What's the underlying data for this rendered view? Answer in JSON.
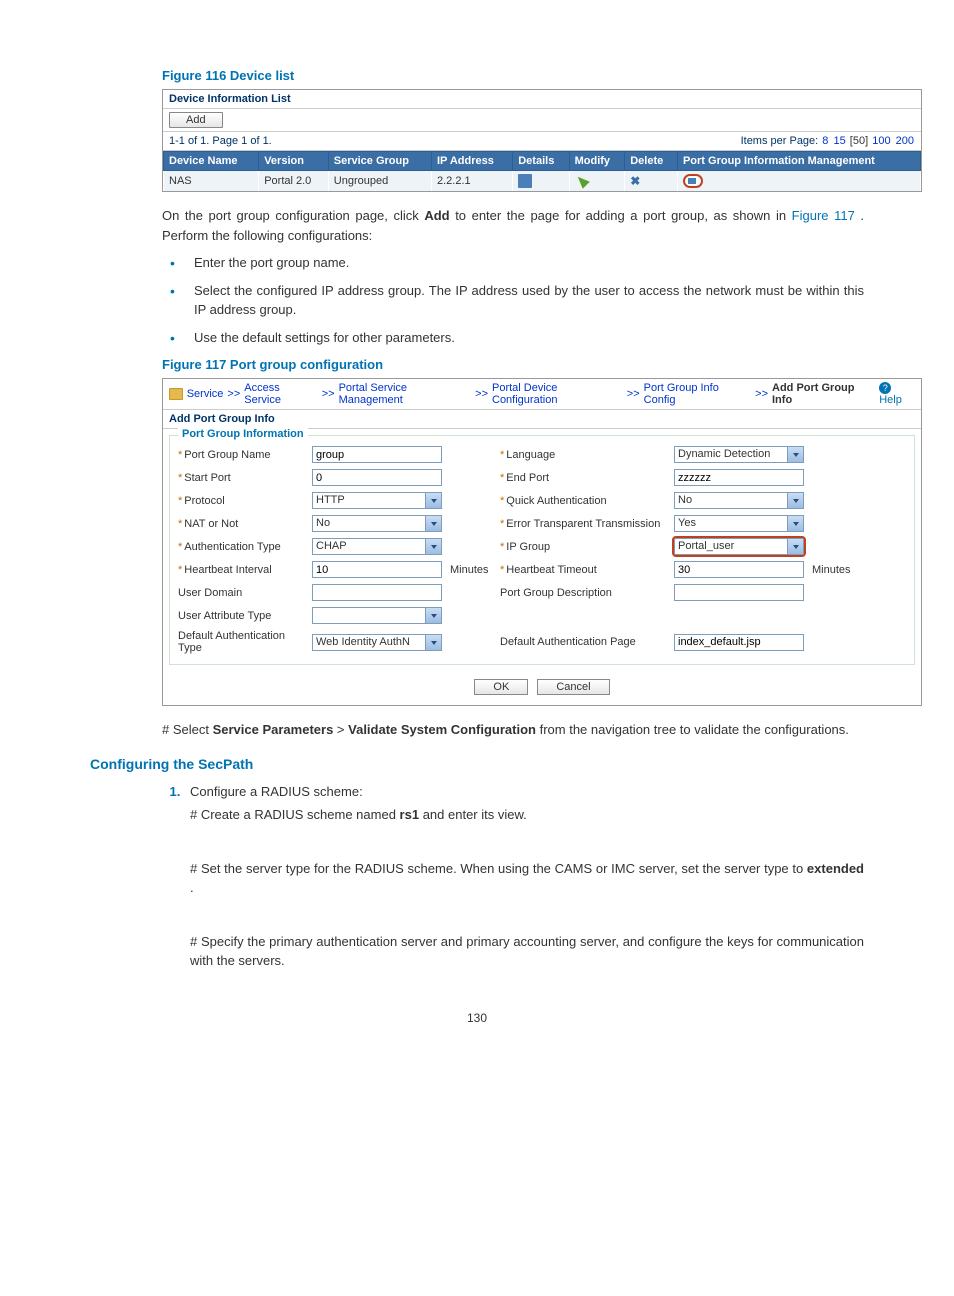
{
  "figure116": {
    "title": "Figure 116 Device list",
    "panel_title": "Device Information List",
    "add_btn": "Add",
    "paging_left": "1-1 of 1. Page 1 of 1.",
    "ipp_label": "Items per Page:",
    "ipp_opts": [
      "8",
      "15",
      "[50]",
      "100",
      "200"
    ],
    "columns": [
      "Device Name",
      "Version",
      "Service Group",
      "IP Address",
      "Details",
      "Modify",
      "Delete",
      "Port Group Information Management"
    ],
    "row": {
      "name": "NAS",
      "version": "Portal 2.0",
      "group": "Ungrouped",
      "ip": "2.2.2.1"
    }
  },
  "para1a": "On the port group configuration page, click ",
  "para1b": " to enter the page for adding a port group, as shown in ",
  "para1c": ". Perform the following configurations:",
  "para1_add": "Add",
  "para1_link": "Figure 117",
  "bullets": [
    "Enter the port group name.",
    "Select the configured IP address group. The IP address used by the user to access the network must be within this IP address group.",
    "Use the default settings for other parameters."
  ],
  "figure117": {
    "title": "Figure 117 Port group configuration",
    "crumbs": [
      "Service",
      "Access Service",
      "Portal Service Management",
      "Portal Device Configuration",
      "Port Group Info Config",
      "Add Port Group Info"
    ],
    "help": "Help",
    "panel_title": "Add Port Group Info",
    "legend": "Port Group Information",
    "labels": {
      "pgname": "Port Group Name",
      "lang": "Language",
      "startport": "Start Port",
      "endport": "End Port",
      "protocol": "Protocol",
      "quickauth": "Quick Authentication",
      "nat": "NAT or Not",
      "ett": "Error Transparent Transmission",
      "authtype": "Authentication Type",
      "ipgroup": "IP Group",
      "hbint": "Heartbeat Interval",
      "hbto": "Heartbeat Timeout",
      "udom": "User Domain",
      "pgdesc": "Port Group Description",
      "uattr": "User Attribute Type",
      "defauthtype": "Default Authentication Type",
      "defauthpage": "Default Authentication Page"
    },
    "values": {
      "pgname": "group",
      "lang": "Dynamic Detection",
      "startport": "0",
      "endport": "zzzzzz",
      "protocol": "HTTP",
      "quickauth": "No",
      "nat": "No",
      "ett": "Yes",
      "authtype": "CHAP",
      "ipgroup": "Portal_user",
      "hbint": "10",
      "hbto": "30",
      "udom": "",
      "pgdesc": "",
      "uattr": "",
      "defauthtype": "Web Identity AuthN",
      "defauthpage": "index_default.jsp"
    },
    "unit_min": "Minutes",
    "ok": "OK",
    "cancel": "Cancel"
  },
  "para2a": "# Select ",
  "para2b": " > ",
  "para2c": " from the navigation tree to validate the configurations.",
  "para2_sp": "Service Parameters",
  "para2_vsc": "Validate System Configuration",
  "h2": "Configuring the SecPath",
  "step1_head": "Configure a RADIUS scheme:",
  "step1_p1a": "# Create a RADIUS scheme named ",
  "step1_p1b": " and enter its view.",
  "step1_rs1": "rs1",
  "step1_p2a": "# Set the server type for the RADIUS scheme. When using the CAMS or IMC server, set the server type to ",
  "step1_p2b": ".",
  "step1_ext": "extended",
  "step1_p3": "# Specify the primary authentication server and primary accounting server, and configure the keys for communication with the servers.",
  "page_num": "130"
}
